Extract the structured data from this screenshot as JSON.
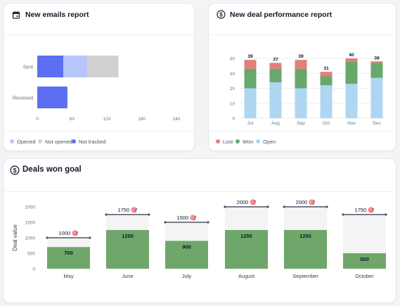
{
  "cards": {
    "emails": {
      "title": "New emails report",
      "icon": "calendar-icon",
      "chart_data": {
        "type": "bar",
        "orientation": "horizontal",
        "stacked": true,
        "categories": [
          "Sent",
          "Received"
        ],
        "series": [
          {
            "name": "Not tracked",
            "color": "#5b6ff0",
            "values": [
              45,
              52
            ]
          },
          {
            "name": "Opened",
            "color": "#b7c6fb",
            "values": [
              42,
              0
            ]
          },
          {
            "name": "Not opened",
            "color": "#d1d1d1",
            "values": [
              53,
              0
            ]
          }
        ],
        "xlim": [
          0,
          240
        ],
        "ticks": [
          "0",
          "60",
          "120",
          "180",
          "240"
        ],
        "grid": false,
        "legend_position": "bottom-left"
      },
      "legend": [
        {
          "label": "Opened",
          "color": "#b7c6fb"
        },
        {
          "label": "Not opened",
          "color": "#d1d1d1"
        },
        {
          "label": "Not tracked",
          "color": "#5b6ff0"
        }
      ]
    },
    "deals": {
      "title": "New deal performance report",
      "icon": "dollar-circle-icon",
      "chart_data": {
        "type": "bar",
        "stacked": true,
        "categories": [
          "Jul",
          "Aug",
          "Sep",
          "Oct",
          "Nov",
          "Dec"
        ],
        "totals": [
          "39",
          "37",
          "39",
          "31",
          "40",
          "38"
        ],
        "series": [
          {
            "name": "Open",
            "color": "#aed6f1",
            "values": [
              20,
              24,
              20,
              22,
              23,
              27
            ]
          },
          {
            "name": "Won",
            "color": "#68a86b",
            "values": [
              13,
              9,
              13,
              6,
              15,
              10
            ]
          },
          {
            "name": "Lost",
            "color": "#e0807b",
            "values": [
              6,
              4,
              6,
              3,
              2,
              1
            ]
          }
        ],
        "ylim": [
          0,
          40
        ],
        "ticks": [
          "0",
          "10",
          "20",
          "30",
          "40"
        ],
        "grid": true,
        "legend_position": "bottom-left"
      },
      "legend": [
        {
          "label": "Lost",
          "color": "#e0807b"
        },
        {
          "label": "Won",
          "color": "#68a86b"
        },
        {
          "label": "Open",
          "color": "#aed6f1"
        }
      ]
    },
    "goal": {
      "title": "Deals won goal",
      "icon": "dollar-circle-icon",
      "chart_data": {
        "type": "bar",
        "categories": [
          "May",
          "June",
          "July",
          "August",
          "September",
          "October"
        ],
        "values": [
          700,
          1250,
          900,
          1250,
          1250,
          500
        ],
        "goals": [
          1000,
          1750,
          1500,
          2000,
          2000,
          1750
        ],
        "value_labels": [
          "700",
          "1250",
          "900",
          "1250",
          "1250",
          "500"
        ],
        "goal_labels": [
          "1000 🎯",
          "1750 🎯",
          "1500 🎯",
          "2000 🎯",
          "2000 🎯",
          "1750 🎯"
        ],
        "bar_color": "#6fa76a",
        "goal_fill": "#f4f4f4",
        "ylabel": "Deal value",
        "ylim": [
          0,
          2000
        ],
        "ticks": [
          "0",
          "500",
          "1000",
          "1500",
          "2000"
        ],
        "grid": false
      }
    }
  }
}
